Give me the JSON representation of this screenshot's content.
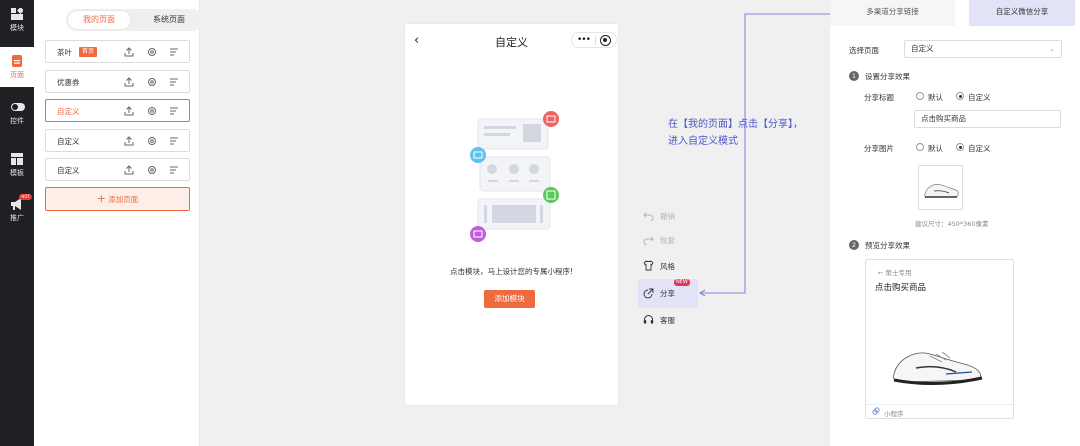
{
  "rail": {
    "items": [
      {
        "label": "模块",
        "icon": "module-icon"
      },
      {
        "label": "页面",
        "icon": "page-icon"
      },
      {
        "label": "控件",
        "icon": "toggle-icon"
      },
      {
        "label": "模板",
        "icon": "template-icon"
      },
      {
        "label": "推广",
        "icon": "megaphone-icon",
        "badge": "HOT"
      }
    ],
    "active_index": 1
  },
  "pages_panel": {
    "tabs": [
      "我的页面",
      "系统页面"
    ],
    "active_tab": 0,
    "rows": [
      {
        "name": "茶叶",
        "tag": "首页"
      },
      {
        "name": "优惠券",
        "tag": ""
      },
      {
        "name": "自定义",
        "tag": ""
      },
      {
        "name": "自定义",
        "tag": ""
      },
      {
        "name": "自定义",
        "tag": ""
      }
    ],
    "selected_row": 2,
    "add_label": "添加页面"
  },
  "phone": {
    "title": "自定义",
    "back": "‹",
    "menu_dots": "•••",
    "hint": "点击模块，马上设计您的专属小程序!",
    "add_module_label": "添加模块"
  },
  "toolbar": [
    {
      "label": "撤销",
      "icon": "undo-icon",
      "state": "disabled"
    },
    {
      "label": "恢复",
      "icon": "redo-icon",
      "state": "disabled"
    },
    {
      "label": "风格",
      "icon": "tshirt-icon",
      "state": "normal"
    },
    {
      "label": "分享",
      "icon": "share-icon",
      "state": "active",
      "badge": "NEW"
    },
    {
      "label": "客服",
      "icon": "headset-icon",
      "state": "normal"
    }
  ],
  "annotation": "在【我的页面】点击【分享】，进入自定义模式",
  "config": {
    "tabs": [
      "多渠道分享链接",
      "自定义微信分享"
    ],
    "active_tab": 1,
    "select_label": "选择页面",
    "select_value": "自定义",
    "step1": {
      "num": "1",
      "title": "设置分享效果"
    },
    "share_title_label": "分享标题",
    "share_image_label": "分享图片",
    "option_default": "默认",
    "option_custom": "自定义",
    "title_value": "点击购买商品",
    "size_hint": "建议尺寸：450*360像素",
    "step2": {
      "num": "2",
      "title": "预览分享效果"
    },
    "preview": {
      "top": "← 策士专用",
      "title": "点击购买商品",
      "footer": "小程序"
    }
  },
  "colors": {
    "accent": "#ef6a3d",
    "rail_bg": "#1e2024",
    "annotation": "#4d58c8",
    "new_badge": "#e8345a"
  }
}
